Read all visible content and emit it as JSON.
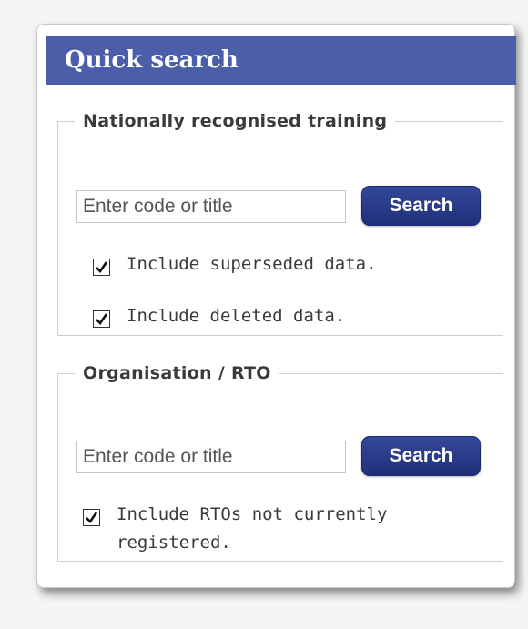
{
  "quick_search": {
    "title": "Quick search",
    "training": {
      "legend": "Nationally recognised training",
      "input_placeholder": "Enter code or title",
      "input_value": "",
      "search_label": "Search",
      "options": [
        {
          "label": "Include superseded data.",
          "checked": true
        },
        {
          "label": "Include deleted data.",
          "checked": true
        }
      ]
    },
    "organisation": {
      "legend": "Organisation / RTO",
      "input_placeholder": "Enter code or title",
      "input_value": "",
      "search_label": "Search",
      "options": [
        {
          "label": "Include RTOs not currently registered.",
          "checked": true
        }
      ]
    }
  },
  "colors": {
    "header_bg": "#4b5eaa",
    "button_bg": "#24357f",
    "header_text": "#ffffff"
  },
  "icons": {
    "checkbox_mark": "checkmark-icon"
  }
}
